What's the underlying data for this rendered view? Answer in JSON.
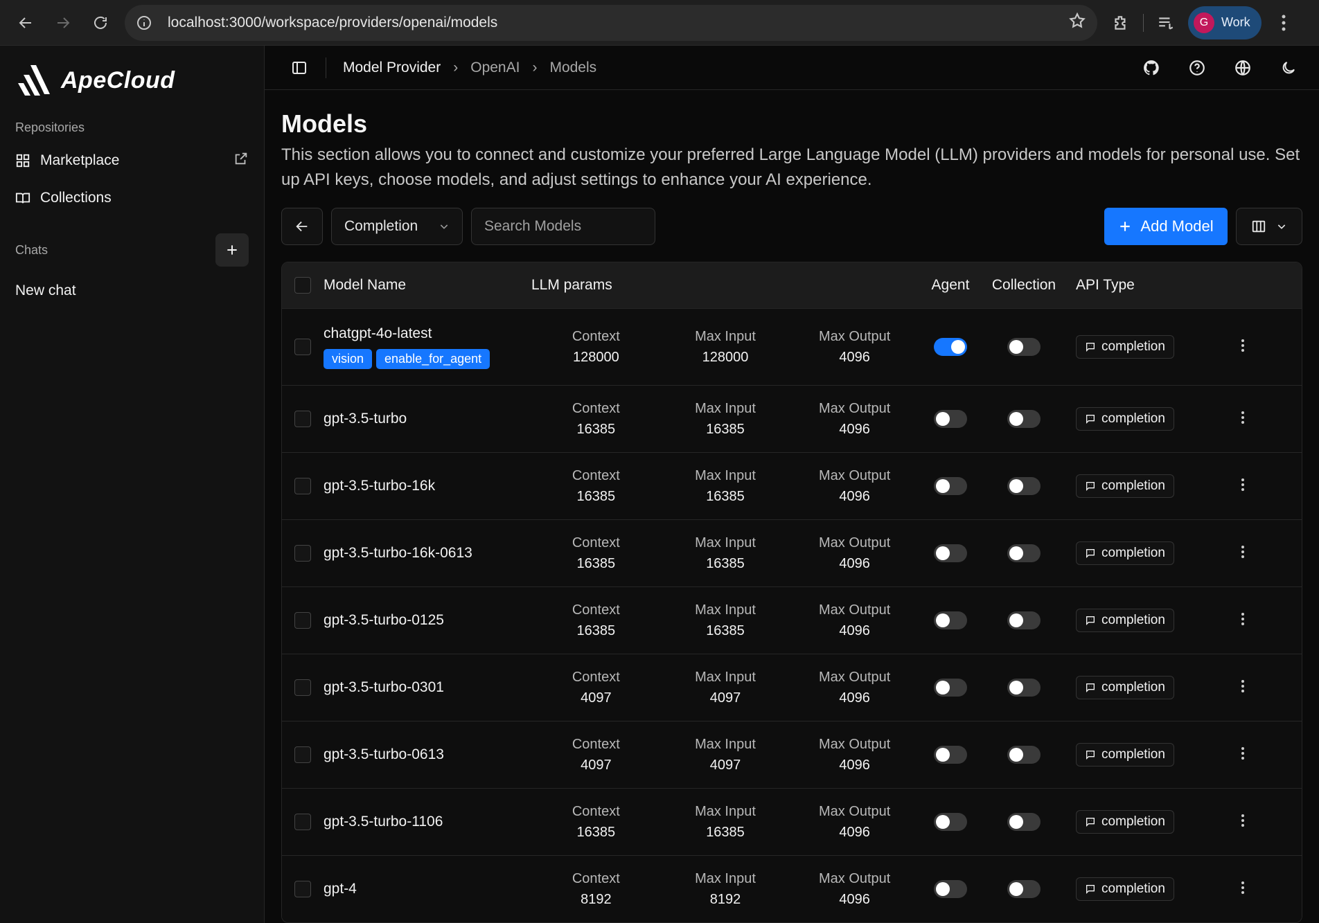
{
  "browser": {
    "url": "localhost:3000/workspace/providers/openai/models",
    "profile_initial": "G",
    "profile_name": "Work"
  },
  "sidebar": {
    "brand": "ApeCloud",
    "repositories_label": "Repositories",
    "marketplace_label": "Marketplace",
    "collections_label": "Collections",
    "chats_label": "Chats",
    "new_chat_label": "New chat"
  },
  "breadcrumb": {
    "root": "Model Provider",
    "provider": "OpenAI",
    "page": "Models"
  },
  "page": {
    "title": "Models",
    "description": "This section allows you to connect and customize your preferred Large Language Model (LLM) providers and models for personal use. Set up API keys, choose models, and adjust settings to enhance your AI experience."
  },
  "toolbar": {
    "filter_value": "Completion",
    "search_placeholder": "Search Models",
    "add_label": "Add Model"
  },
  "table": {
    "headers": {
      "name": "Model Name",
      "params": "LLM params",
      "agent": "Agent",
      "collection": "Collection",
      "api": "API Type"
    },
    "param_labels": {
      "context": "Context",
      "max_input": "Max Input",
      "max_output": "Max Output"
    },
    "rows": [
      {
        "name": "chatgpt-4o-latest",
        "tags": [
          "vision",
          "enable_for_agent"
        ],
        "context": "128000",
        "max_input": "128000",
        "max_output": "4096",
        "agent": true,
        "collection": false,
        "api": "completion"
      },
      {
        "name": "gpt-3.5-turbo",
        "tags": [],
        "context": "16385",
        "max_input": "16385",
        "max_output": "4096",
        "agent": false,
        "collection": false,
        "api": "completion"
      },
      {
        "name": "gpt-3.5-turbo-16k",
        "tags": [],
        "context": "16385",
        "max_input": "16385",
        "max_output": "4096",
        "agent": false,
        "collection": false,
        "api": "completion"
      },
      {
        "name": "gpt-3.5-turbo-16k-0613",
        "tags": [],
        "context": "16385",
        "max_input": "16385",
        "max_output": "4096",
        "agent": false,
        "collection": false,
        "api": "completion"
      },
      {
        "name": "gpt-3.5-turbo-0125",
        "tags": [],
        "context": "16385",
        "max_input": "16385",
        "max_output": "4096",
        "agent": false,
        "collection": false,
        "api": "completion"
      },
      {
        "name": "gpt-3.5-turbo-0301",
        "tags": [],
        "context": "4097",
        "max_input": "4097",
        "max_output": "4096",
        "agent": false,
        "collection": false,
        "api": "completion"
      },
      {
        "name": "gpt-3.5-turbo-0613",
        "tags": [],
        "context": "4097",
        "max_input": "4097",
        "max_output": "4096",
        "agent": false,
        "collection": false,
        "api": "completion"
      },
      {
        "name": "gpt-3.5-turbo-1106",
        "tags": [],
        "context": "16385",
        "max_input": "16385",
        "max_output": "4096",
        "agent": false,
        "collection": false,
        "api": "completion"
      },
      {
        "name": "gpt-4",
        "tags": [],
        "context": "8192",
        "max_input": "8192",
        "max_output": "4096",
        "agent": false,
        "collection": false,
        "api": "completion"
      }
    ]
  },
  "colors": {
    "accent": "#1677ff",
    "background": "#0a0a0a"
  }
}
